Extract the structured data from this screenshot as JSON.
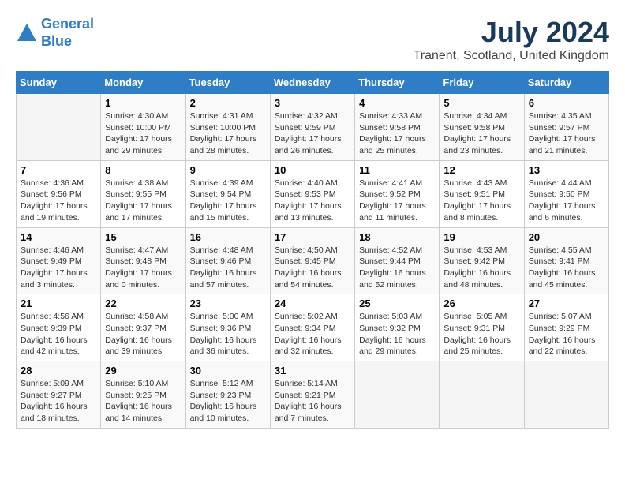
{
  "logo": {
    "line1": "General",
    "line2": "Blue"
  },
  "title": "July 2024",
  "location": "Tranent, Scotland, United Kingdom",
  "days_of_week": [
    "Sunday",
    "Monday",
    "Tuesday",
    "Wednesday",
    "Thursday",
    "Friday",
    "Saturday"
  ],
  "weeks": [
    [
      {
        "day": "",
        "sunrise": "",
        "sunset": "",
        "daylight": ""
      },
      {
        "day": "1",
        "sunrise": "Sunrise: 4:30 AM",
        "sunset": "Sunset: 10:00 PM",
        "daylight": "Daylight: 17 hours and 29 minutes."
      },
      {
        "day": "2",
        "sunrise": "Sunrise: 4:31 AM",
        "sunset": "Sunset: 10:00 PM",
        "daylight": "Daylight: 17 hours and 28 minutes."
      },
      {
        "day": "3",
        "sunrise": "Sunrise: 4:32 AM",
        "sunset": "Sunset: 9:59 PM",
        "daylight": "Daylight: 17 hours and 26 minutes."
      },
      {
        "day": "4",
        "sunrise": "Sunrise: 4:33 AM",
        "sunset": "Sunset: 9:58 PM",
        "daylight": "Daylight: 17 hours and 25 minutes."
      },
      {
        "day": "5",
        "sunrise": "Sunrise: 4:34 AM",
        "sunset": "Sunset: 9:58 PM",
        "daylight": "Daylight: 17 hours and 23 minutes."
      },
      {
        "day": "6",
        "sunrise": "Sunrise: 4:35 AM",
        "sunset": "Sunset: 9:57 PM",
        "daylight": "Daylight: 17 hours and 21 minutes."
      }
    ],
    [
      {
        "day": "7",
        "sunrise": "Sunrise: 4:36 AM",
        "sunset": "Sunset: 9:56 PM",
        "daylight": "Daylight: 17 hours and 19 minutes."
      },
      {
        "day": "8",
        "sunrise": "Sunrise: 4:38 AM",
        "sunset": "Sunset: 9:55 PM",
        "daylight": "Daylight: 17 hours and 17 minutes."
      },
      {
        "day": "9",
        "sunrise": "Sunrise: 4:39 AM",
        "sunset": "Sunset: 9:54 PM",
        "daylight": "Daylight: 17 hours and 15 minutes."
      },
      {
        "day": "10",
        "sunrise": "Sunrise: 4:40 AM",
        "sunset": "Sunset: 9:53 PM",
        "daylight": "Daylight: 17 hours and 13 minutes."
      },
      {
        "day": "11",
        "sunrise": "Sunrise: 4:41 AM",
        "sunset": "Sunset: 9:52 PM",
        "daylight": "Daylight: 17 hours and 11 minutes."
      },
      {
        "day": "12",
        "sunrise": "Sunrise: 4:43 AM",
        "sunset": "Sunset: 9:51 PM",
        "daylight": "Daylight: 17 hours and 8 minutes."
      },
      {
        "day": "13",
        "sunrise": "Sunrise: 4:44 AM",
        "sunset": "Sunset: 9:50 PM",
        "daylight": "Daylight: 17 hours and 6 minutes."
      }
    ],
    [
      {
        "day": "14",
        "sunrise": "Sunrise: 4:46 AM",
        "sunset": "Sunset: 9:49 PM",
        "daylight": "Daylight: 17 hours and 3 minutes."
      },
      {
        "day": "15",
        "sunrise": "Sunrise: 4:47 AM",
        "sunset": "Sunset: 9:48 PM",
        "daylight": "Daylight: 17 hours and 0 minutes."
      },
      {
        "day": "16",
        "sunrise": "Sunrise: 4:48 AM",
        "sunset": "Sunset: 9:46 PM",
        "daylight": "Daylight: 16 hours and 57 minutes."
      },
      {
        "day": "17",
        "sunrise": "Sunrise: 4:50 AM",
        "sunset": "Sunset: 9:45 PM",
        "daylight": "Daylight: 16 hours and 54 minutes."
      },
      {
        "day": "18",
        "sunrise": "Sunrise: 4:52 AM",
        "sunset": "Sunset: 9:44 PM",
        "daylight": "Daylight: 16 hours and 52 minutes."
      },
      {
        "day": "19",
        "sunrise": "Sunrise: 4:53 AM",
        "sunset": "Sunset: 9:42 PM",
        "daylight": "Daylight: 16 hours and 48 minutes."
      },
      {
        "day": "20",
        "sunrise": "Sunrise: 4:55 AM",
        "sunset": "Sunset: 9:41 PM",
        "daylight": "Daylight: 16 hours and 45 minutes."
      }
    ],
    [
      {
        "day": "21",
        "sunrise": "Sunrise: 4:56 AM",
        "sunset": "Sunset: 9:39 PM",
        "daylight": "Daylight: 16 hours and 42 minutes."
      },
      {
        "day": "22",
        "sunrise": "Sunrise: 4:58 AM",
        "sunset": "Sunset: 9:37 PM",
        "daylight": "Daylight: 16 hours and 39 minutes."
      },
      {
        "day": "23",
        "sunrise": "Sunrise: 5:00 AM",
        "sunset": "Sunset: 9:36 PM",
        "daylight": "Daylight: 16 hours and 36 minutes."
      },
      {
        "day": "24",
        "sunrise": "Sunrise: 5:02 AM",
        "sunset": "Sunset: 9:34 PM",
        "daylight": "Daylight: 16 hours and 32 minutes."
      },
      {
        "day": "25",
        "sunrise": "Sunrise: 5:03 AM",
        "sunset": "Sunset: 9:32 PM",
        "daylight": "Daylight: 16 hours and 29 minutes."
      },
      {
        "day": "26",
        "sunrise": "Sunrise: 5:05 AM",
        "sunset": "Sunset: 9:31 PM",
        "daylight": "Daylight: 16 hours and 25 minutes."
      },
      {
        "day": "27",
        "sunrise": "Sunrise: 5:07 AM",
        "sunset": "Sunset: 9:29 PM",
        "daylight": "Daylight: 16 hours and 22 minutes."
      }
    ],
    [
      {
        "day": "28",
        "sunrise": "Sunrise: 5:09 AM",
        "sunset": "Sunset: 9:27 PM",
        "daylight": "Daylight: 16 hours and 18 minutes."
      },
      {
        "day": "29",
        "sunrise": "Sunrise: 5:10 AM",
        "sunset": "Sunset: 9:25 PM",
        "daylight": "Daylight: 16 hours and 14 minutes."
      },
      {
        "day": "30",
        "sunrise": "Sunrise: 5:12 AM",
        "sunset": "Sunset: 9:23 PM",
        "daylight": "Daylight: 16 hours and 10 minutes."
      },
      {
        "day": "31",
        "sunrise": "Sunrise: 5:14 AM",
        "sunset": "Sunset: 9:21 PM",
        "daylight": "Daylight: 16 hours and 7 minutes."
      },
      {
        "day": "",
        "sunrise": "",
        "sunset": "",
        "daylight": ""
      },
      {
        "day": "",
        "sunrise": "",
        "sunset": "",
        "daylight": ""
      },
      {
        "day": "",
        "sunrise": "",
        "sunset": "",
        "daylight": ""
      }
    ]
  ]
}
